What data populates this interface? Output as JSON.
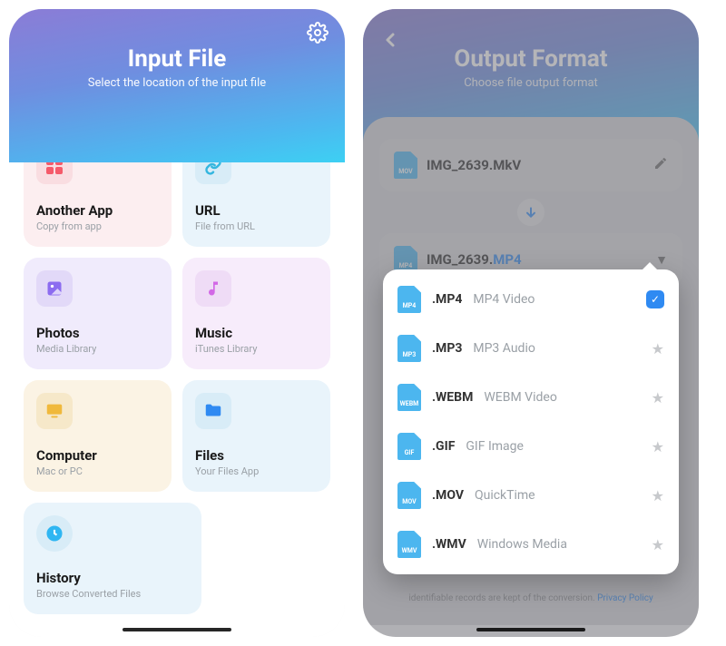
{
  "left": {
    "title": "Input File",
    "subtitle": "Select the location of the input file",
    "cards": {
      "app": {
        "title": "Another App",
        "sub": "Copy from app"
      },
      "url": {
        "title": "URL",
        "sub": "File from URL"
      },
      "photo": {
        "title": "Photos",
        "sub": "Media Library"
      },
      "music": {
        "title": "Music",
        "sub": "iTunes Library"
      },
      "comp": {
        "title": "Computer",
        "sub": "Mac or PC"
      },
      "files": {
        "title": "Files",
        "sub": "Your Files App"
      },
      "hist": {
        "title": "History",
        "sub": "Browse Converted Files"
      }
    }
  },
  "right": {
    "title": "Output Format",
    "subtitle": "Choose file output format",
    "source": {
      "name": "IMG_2639.",
      "ext": "MkV",
      "badge": "MOV"
    },
    "target": {
      "name": "IMG_2639.",
      "ext": "MP4",
      "badge": "MP4"
    },
    "options": [
      {
        "badge": "MP4",
        "ext": ".MP4",
        "desc": "MP4 Video",
        "selected": true
      },
      {
        "badge": "MP3",
        "ext": ".MP3",
        "desc": "MP3 Audio",
        "selected": false
      },
      {
        "badge": "WEBM",
        "ext": ".WEBM",
        "desc": "WEBM Video",
        "selected": false
      },
      {
        "badge": "GIF",
        "ext": ".GIF",
        "desc": "GIF Image",
        "selected": false
      },
      {
        "badge": "MOV",
        "ext": ".MOV",
        "desc": "QuickTime",
        "selected": false
      },
      {
        "badge": "WMV",
        "ext": ".WMV",
        "desc": "Windows Media",
        "selected": false
      }
    ],
    "footer": {
      "text": "identifiable records are kept of the conversion.",
      "link": "Privacy Policy"
    }
  }
}
